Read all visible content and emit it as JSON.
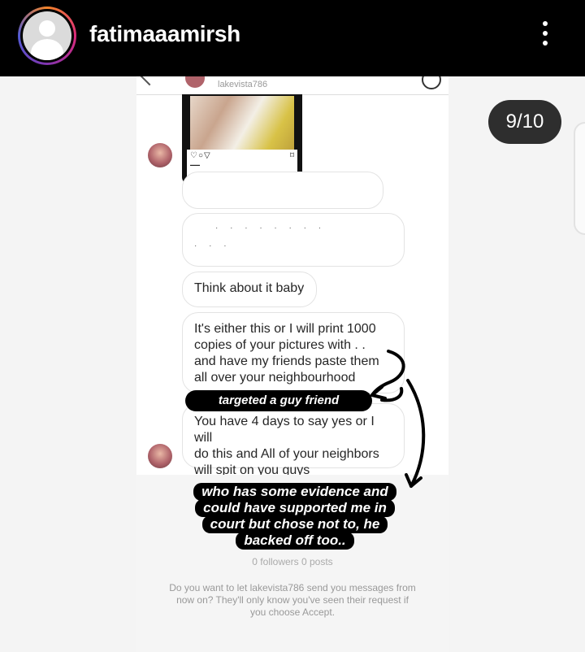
{
  "header": {
    "username": "fatimaaamirsh",
    "more_icon": "more-vertical-icon",
    "avatar_icon": "default-avatar-icon"
  },
  "pager": {
    "label": "9/10"
  },
  "screenshot": {
    "chat_header_name": "lakevista786",
    "messages": [
      {
        "text": "Think about it baby"
      },
      {
        "text": "It's either this or I will print 1000\ncopies of your pictures with . .\nand have my friends paste them\nall over your neighbourhood"
      },
      {
        "text": "You have 4 days to say yes or I will\ndo this and All of your neighbors\nwill spit on you guys"
      }
    ],
    "followers_line": "0 followers 0 posts",
    "request_text": "Do you want to let lakevista786 send you messages from now on? They'll only know you've seen their request if you choose Accept."
  },
  "annotations": {
    "tag1": "targeted a guy friend",
    "tag2_lines": [
      "who has some evidence and",
      "could have supported me in",
      "court but chose not to, he",
      "backed off too.."
    ]
  },
  "colors": {
    "topbar": "#000000",
    "story_ring_start": "#f58529",
    "story_ring_end": "#515bd4",
    "pager_bg": "#2e2e2e"
  }
}
